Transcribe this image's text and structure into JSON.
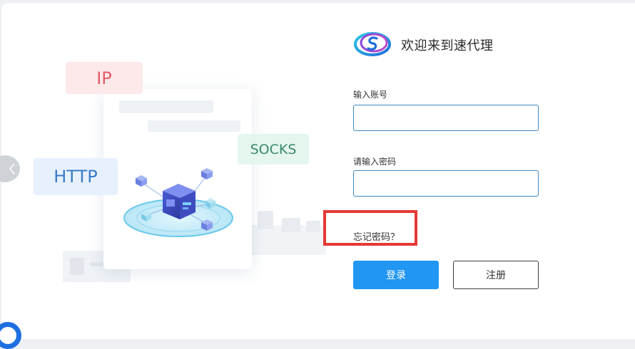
{
  "login": {
    "welcome_text": "欢迎来到速代理",
    "account_label": "输入账号",
    "account_value": "",
    "password_label": "请输入密码",
    "password_value": "",
    "forgot_password": "忘记密码？",
    "login_button": "登录",
    "register_button": "注册"
  },
  "illustration": {
    "tags": {
      "ip": "IP",
      "http": "HTTP",
      "socks": "SOCKS"
    }
  },
  "icons": {
    "logo": "su-proxy-logo",
    "carousel_prev": "chevron-left-icon",
    "floating_badge": "ring-icon"
  },
  "colors": {
    "primary": "#2196f3",
    "input_border": "#3d87c2",
    "highlight": "#e53935",
    "ip_tag": "#e25b67",
    "http_tag": "#3a7cc7",
    "socks_tag": "#3b8a6c"
  }
}
